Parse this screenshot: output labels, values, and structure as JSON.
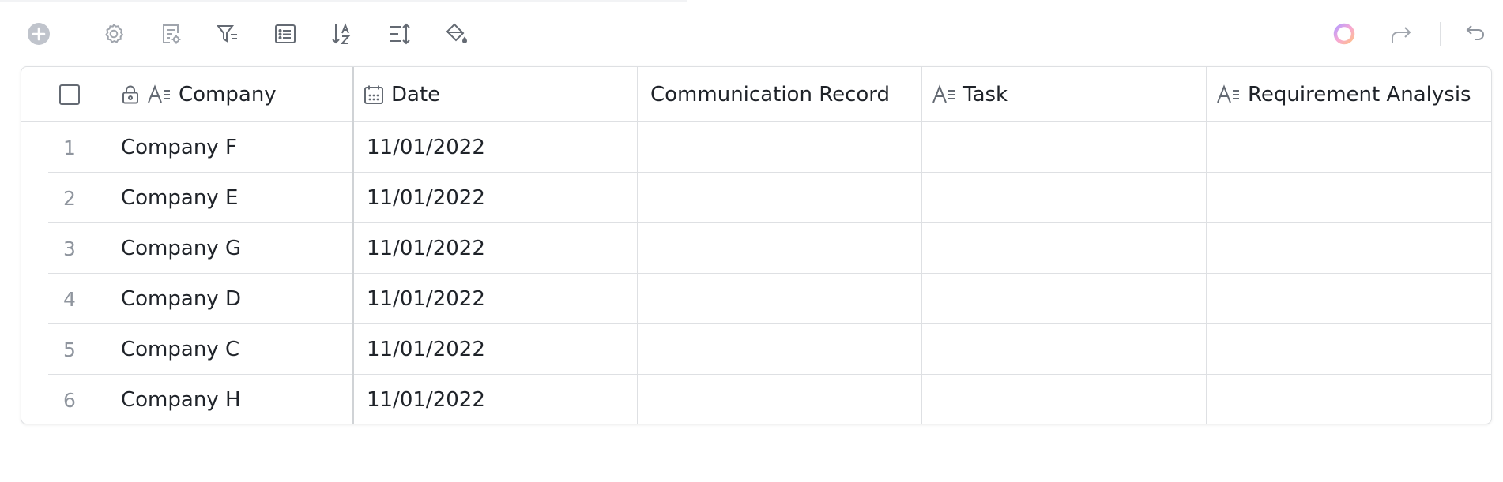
{
  "colors": {
    "accent": "#3370ff",
    "icon": "#646a73",
    "icon_muted": "#c0c4cc",
    "grid": "#dee0e3",
    "row_number": "#8f959e"
  },
  "toolbar": {
    "left_icons": [
      "add-record-icon",
      "settings-icon",
      "form-settings-icon",
      "filter-icon",
      "field-list-icon",
      "sort-icon",
      "row-height-icon",
      "fill-color-icon"
    ],
    "right_icons": [
      "ai-assistant-icon",
      "redo-icon",
      "undo-icon"
    ]
  },
  "table": {
    "columns": [
      {
        "label": "Company",
        "icons": [
          "lock-icon",
          "text-field-icon"
        ]
      },
      {
        "label": "Date",
        "icons": [
          "calendar-icon"
        ]
      },
      {
        "label": "Communication Record",
        "icons": []
      },
      {
        "label": "Task",
        "icons": [
          "text-field-icon"
        ]
      },
      {
        "label": "Requirement Analysis",
        "icons": [
          "text-field-icon"
        ]
      }
    ],
    "rows": [
      {
        "num": "1",
        "company": "Company F",
        "date": "11/01/2022",
        "communication": "",
        "task": "",
        "requirement": ""
      },
      {
        "num": "2",
        "company": "Company E",
        "date": "11/01/2022",
        "communication": "",
        "task": "",
        "requirement": ""
      },
      {
        "num": "3",
        "company": "Company G",
        "date": "11/01/2022",
        "communication": "",
        "task": "",
        "requirement": ""
      },
      {
        "num": "4",
        "company": "Company D",
        "date": "11/01/2022",
        "communication": "",
        "task": "",
        "requirement": ""
      },
      {
        "num": "5",
        "company": "Company C",
        "date": "11/01/2022",
        "communication": "",
        "task": "",
        "requirement": ""
      },
      {
        "num": "6",
        "company": "Company H",
        "date": "11/01/2022",
        "communication": "",
        "task": "",
        "requirement": ""
      }
    ]
  }
}
